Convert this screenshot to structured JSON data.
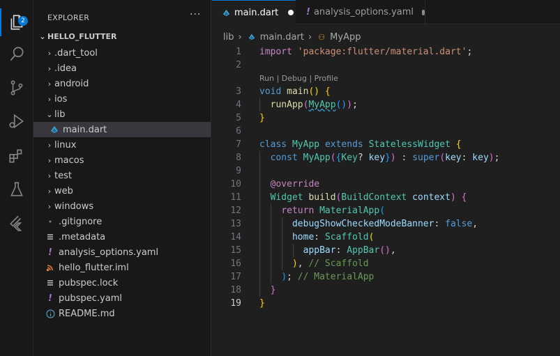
{
  "explorer": {
    "title": "EXPLORER",
    "more": "···",
    "project": "HELLO_FLUTTER",
    "badge": "2",
    "items": [
      {
        "label": ".dart_tool",
        "type": "folder"
      },
      {
        "label": ".idea",
        "type": "folder"
      },
      {
        "label": "android",
        "type": "folder"
      },
      {
        "label": "ios",
        "type": "folder"
      },
      {
        "label": "lib",
        "type": "folder-open"
      },
      {
        "label": "main.dart",
        "type": "dart"
      },
      {
        "label": "linux",
        "type": "folder"
      },
      {
        "label": "macos",
        "type": "folder"
      },
      {
        "label": "test",
        "type": "folder"
      },
      {
        "label": "web",
        "type": "folder"
      },
      {
        "label": "windows",
        "type": "folder"
      },
      {
        "label": ".gitignore",
        "type": "gitignore"
      },
      {
        "label": ".metadata",
        "type": "list"
      },
      {
        "label": "analysis_options.yaml",
        "type": "yaml"
      },
      {
        "label": "hello_flutter.iml",
        "type": "rss"
      },
      {
        "label": "pubspec.lock",
        "type": "list"
      },
      {
        "label": "pubspec.yaml",
        "type": "yaml"
      },
      {
        "label": "README.md",
        "type": "info"
      }
    ]
  },
  "tabs": [
    {
      "label": "main.dart",
      "state": "active",
      "modified": true
    },
    {
      "label": "analysis_options.yaml",
      "state": "inactive",
      "modified": true
    }
  ],
  "breadcrumb": {
    "folder": "lib",
    "file": "main.dart",
    "symbol": "MyApp"
  },
  "codelens": "Run | Debug | Profile",
  "line_numbers": [
    "1",
    "2",
    "3",
    "4",
    "5",
    "6",
    "7",
    "8",
    "9",
    "10",
    "11",
    "12",
    "13",
    "14",
    "15",
    "16",
    "17",
    "18",
    "19"
  ],
  "current_line": "19",
  "colors": {
    "accent": "#0078d4",
    "dart": "#41a6d4",
    "yaml": "#a074c4",
    "rss": "#e37933"
  }
}
